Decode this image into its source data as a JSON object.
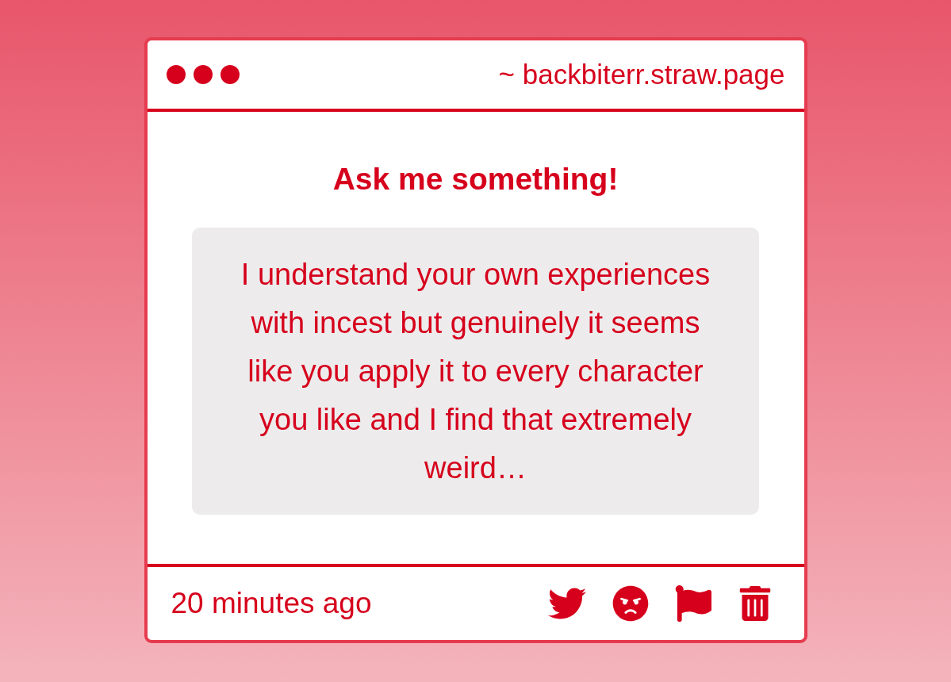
{
  "window": {
    "address": "~ backbiterr.straw.page"
  },
  "question": {
    "heading": "Ask me something!",
    "text": "I understand your own experiences with incest but genuinely it seems like you apply it to every character you like and I find that extremely weird…"
  },
  "footer": {
    "time": "20 minutes ago"
  }
}
